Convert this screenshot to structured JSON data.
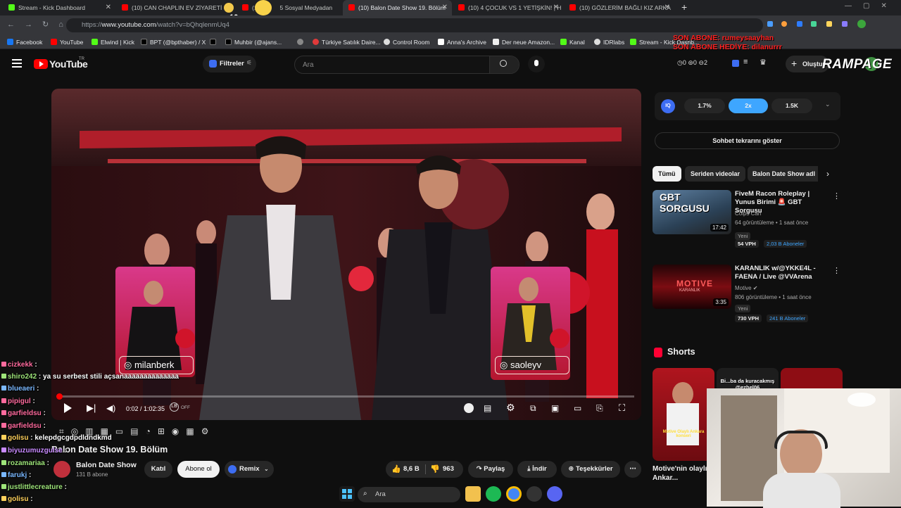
{
  "tabs": [
    {
      "label": "Stream - Kick Dashboard",
      "icon": "kick-icon",
      "color": "#53fc18"
    },
    {
      "label": "(10) CAN CHAPLIN EV ZİYARETİ",
      "icon": "youtube-icon",
      "color": "#ff0000"
    },
    {
      "label": "(10)",
      "icon": "youtube-icon",
      "color": "#ff0000"
    },
    {
      "label": "5 Sosyal Medyadan",
      "icon": "youtube-icon",
      "color": "#ff0000"
    },
    {
      "label": "(10) Balon Date Show 19. Bölüm",
      "icon": "youtube-icon",
      "color": "#ff0000"
    },
    {
      "label": "(10) 4 ÇOCUK VS 1 YETİŞKİN! | H",
      "icon": "youtube-icon",
      "color": "#ff0000"
    },
    {
      "label": "(10) GÖZLERİM BAĞLI KIZ ARKA",
      "icon": "youtube-icon",
      "color": "#ff0000"
    }
  ],
  "overlay_emotes": {
    "first": "x10",
    "second": "x5"
  },
  "address": {
    "prefix": "https://",
    "host": "www.youtube.com",
    "path": "/watch?v=bQhqlenmUq4"
  },
  "bookmarks": [
    "Facebook",
    "YouTube",
    "Elwind | Kick",
    "BPT (@bpthaber) / X",
    "",
    "Muhbir (@ajans...",
    "",
    "Türkiye Satılık Daire...",
    "Control Room",
    "Anna's Archive",
    "Der neue Amazon...",
    "Kanal",
    "IDRlabs",
    "Stream - Kick Dashb..."
  ],
  "stream_overlay": {
    "line1": "SON ABONE: rumeysaayhan",
    "line2": "SON ABONE HEDİYE: dilanurrr",
    "brand": "RAMPAGE"
  },
  "youtube": {
    "logo": "YouTube",
    "logo_sup": "TR",
    "filters_label": "Filtreler",
    "search_placeholder": "Ara",
    "counters": [
      "0",
      "0",
      "2"
    ],
    "create_label": "Oluştur"
  },
  "video": {
    "name_left": "milanberk",
    "name_right": "saoleyv",
    "time": "0:02 / 1:02:35",
    "off": "OFF",
    "title": "Balon Date Show 19. Bölüm"
  },
  "channel": {
    "name": "Balon Date Show",
    "subs": "131 B abone",
    "join_label": "Katıl",
    "subscribe_label": "Abone ol",
    "remix_label": "Remix"
  },
  "actions": {
    "likes": "8,6 B",
    "dislikes": "963",
    "share": "Paylaş",
    "download": "İndir",
    "thanks": "Teşekkürler"
  },
  "speed": {
    "options": [
      "1.7%",
      "2x",
      "1.5K"
    ],
    "selected": 1
  },
  "sidebar": {
    "show_chat": "Sohbet tekrarını göster",
    "chips": [
      "Tümü",
      "Seriden videolar",
      "Balon Date Show adl"
    ],
    "items": [
      {
        "thumb_text": "GBT SORGUSU",
        "duration": "17:42",
        "title": "FiveM Racon Roleplay | Yunus Birimi 🚨 GBT Sorgusu",
        "channel": "Coips Can",
        "meta": "64 görüntüleme • 1 saat önce",
        "badge": "Yeni",
        "vph": "54 VPH",
        "subs": "2,03 B Aboneler",
        "color": "#6fa0c8"
      },
      {
        "thumb_text": "MOTIVE",
        "thumb_sub": "KARANLIK",
        "duration": "3:35",
        "title": "KARANLIK w/@YKKE4L - FAENA / Live @VVArena",
        "channel": "Motive",
        "meta": "806 görüntüleme • 1 saat önce",
        "badge": "Yeni",
        "vph": "730 VPH",
        "subs": "241 B Aboneler",
        "color": "#c8282a"
      }
    ],
    "shorts_title": "Shorts",
    "shorts": [
      {
        "title": "Motive'nin olaylı Ankar...",
        "caption": "Motive Olaylı Ankara konseri"
      },
      {
        "title": "",
        "caption": "Bi...ba da kuracakmış @ezhel06"
      }
    ]
  },
  "chat": [
    {
      "user": "cizkekk",
      "msg": "",
      "color": "#ff6b9e"
    },
    {
      "user": "shiro242",
      "msg": "ya su serbest stili açsanaaaaaaaaaaaaaa",
      "color": "#9ee57a"
    },
    {
      "user": "blueaeri",
      "msg": "",
      "color": "#7ab8ff"
    },
    {
      "user": "pipigul",
      "msg": "",
      "color": "#ff6b9e"
    },
    {
      "user": "garfieldsu",
      "msg": "",
      "color": "#ff6b9e"
    },
    {
      "user": "garfieldsu",
      "msg": "",
      "color": "#ff6b9e"
    },
    {
      "user": "golisu",
      "msg": "kelepdgcgdpdldndkmd",
      "color": "#ffd15c"
    },
    {
      "user": "biyuzumuzgulse",
      "msg": "",
      "color": "#c98bff"
    },
    {
      "user": "rozamariaa",
      "msg": "",
      "color": "#9ee57a"
    },
    {
      "user": "farukj",
      "msg": "",
      "color": "#7ab8ff"
    },
    {
      "user": "justlittlecreature",
      "msg": "",
      "color": "#9ee57a"
    },
    {
      "user": "golisu",
      "msg": "",
      "color": "#ffd15c"
    }
  ],
  "taskbar": {
    "search": "Ara"
  }
}
